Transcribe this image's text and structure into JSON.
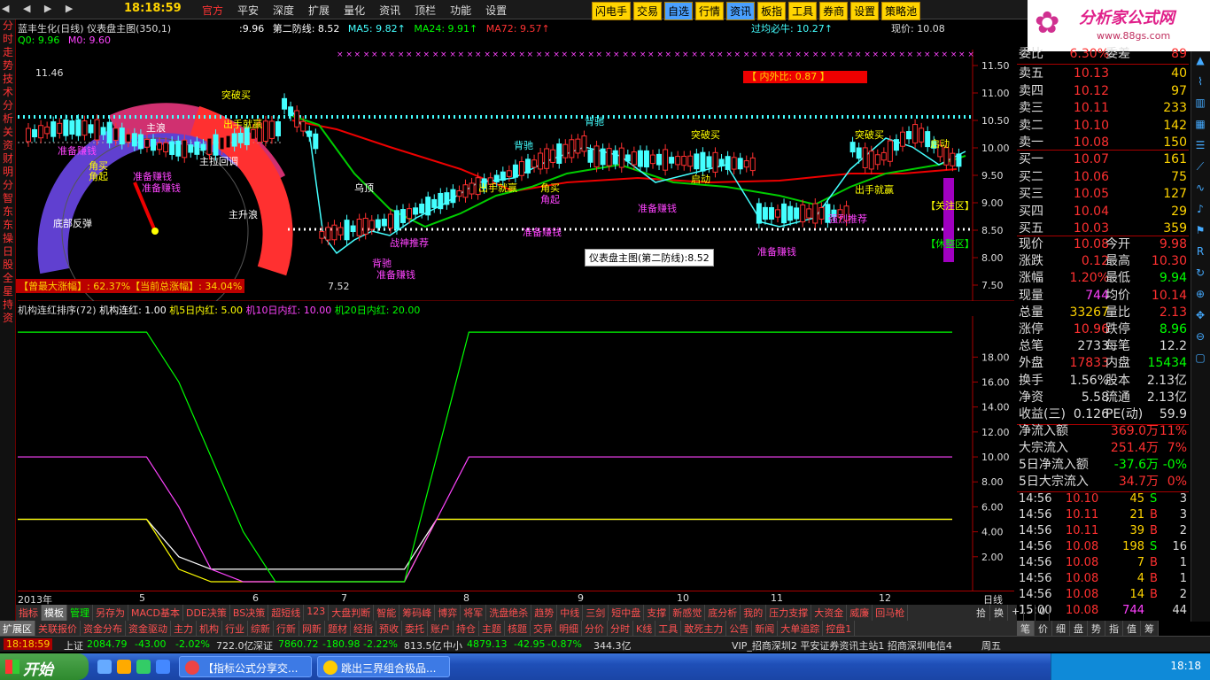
{
  "topbar": {
    "nav_symbols": "◀ ◀ ▶ ▶",
    "time": "18:18:59",
    "menu": [
      "官方",
      "平安",
      "深度",
      "扩展",
      "量化",
      "资讯",
      "顶栏",
      "功能",
      "设置"
    ],
    "tools": [
      "闪电手",
      "交易",
      "自选",
      "行情",
      "资讯",
      "板指",
      "工具",
      "券商",
      "设置",
      "策略池"
    ]
  },
  "logo": {
    "title": "分析家公式网",
    "url_text": "www.88gs.com"
  },
  "left_tabs": [
    "分",
    "时",
    "走",
    "势",
    "技",
    "术",
    "分",
    "析",
    "关",
    "资",
    "财",
    "明",
    "分",
    "智",
    "东",
    "东",
    "操",
    "日",
    "股",
    "全",
    "星",
    "持",
    "资"
  ],
  "chart_info": {
    "title": "蓝丰生化(日线) 仪表盘主图(350,1)",
    "line1_val": ":9.96",
    "second_defense": "第二防线: 8.52",
    "ma5": "MA5: 9.82↑",
    "ma24": "MA24: 9.91↑",
    "ma72": "MA72: 9.57↑",
    "q0": "Q0: 9.96",
    "m0": "M0: 9.60",
    "guojun": "过均必牛: 10.27↑",
    "price": "现价: 10.08"
  },
  "main_chart": {
    "y_ticks": [
      "11.50",
      "11.00",
      "10.50",
      "10.00",
      "9.50",
      "9.00",
      "8.50",
      "8.00",
      "7.50"
    ],
    "high_label": "11.46",
    "low_label": "7.52",
    "neiwai": "【 内外比: 0.87 】",
    "tooltip": "仪表盘主图(第二防线):8.52",
    "risk": "【曾最大涨幅】: 62.37%【当前总涨幅】: 34.04%",
    "gauge_labels": [
      "主浪",
      "主升浪",
      "底部反弹",
      "主拉回调"
    ],
    "signals": [
      "准备赚钱",
      "突破买",
      "出手就赢",
      "角买",
      "角起",
      "乌顶",
      "战神推荐",
      "背驰",
      "强烈推荐",
      "启动",
      "关注区",
      "休整区"
    ]
  },
  "sub_chart": {
    "title": "机构连红排序(72)",
    "l1": "机构连红: 1.00",
    "l2": "机5日内红: 5.00",
    "l3": "机10日内红: 10.00",
    "l4": "机20日内红: 20.00",
    "y_ticks": [
      "18.00",
      "16.00",
      "14.00",
      "12.00",
      "10.00",
      "8.00",
      "6.00",
      "4.00",
      "2.00"
    ],
    "series": [
      {
        "name": "机构连红",
        "values": [
          5,
          5,
          5,
          5,
          5,
          2,
          1,
          1,
          1,
          1,
          1,
          1,
          1,
          5,
          5,
          5,
          5,
          5,
          5,
          5,
          5,
          5,
          5,
          5,
          5,
          5,
          5,
          5,
          5,
          5
        ]
      },
      {
        "name": "机5日内红",
        "values": [
          5,
          5,
          5,
          5,
          5,
          1,
          0,
          0,
          0,
          0,
          0,
          0,
          0,
          5,
          5,
          5,
          5,
          5,
          5,
          5,
          5,
          5,
          5,
          5,
          5,
          5,
          5,
          5,
          5,
          5
        ]
      },
      {
        "name": "机10日内红",
        "values": [
          10,
          10,
          10,
          10,
          10,
          6,
          1,
          0,
          0,
          0,
          0,
          0,
          0,
          5,
          10,
          10,
          10,
          10,
          10,
          10,
          10,
          10,
          10,
          10,
          10,
          10,
          10,
          10,
          10,
          10
        ]
      },
      {
        "name": "机20日内红",
        "values": [
          20,
          20,
          20,
          20,
          20,
          16,
          10,
          4,
          0,
          0,
          0,
          0,
          0,
          10,
          20,
          20,
          20,
          20,
          20,
          20,
          20,
          20,
          20,
          20,
          20,
          20,
          20,
          20,
          20,
          20
        ]
      }
    ]
  },
  "x_axis": {
    "year": "2013年",
    "months": [
      "5",
      "6",
      "7",
      "8",
      "9",
      "10",
      "11",
      "12"
    ],
    "period": "日线"
  },
  "tabs1": [
    "指标",
    "模板",
    "管理",
    "另存为",
    "MACD基本",
    "DDE决策",
    "BS决策",
    "超短线",
    "123",
    "大盘判断",
    "智能",
    "筹码峰",
    "博弈",
    "将军",
    "洗盘绝杀",
    "趋势",
    "中线",
    "三剑",
    "短中盘",
    "支撑",
    "新感觉",
    "底分析",
    "我的",
    "压力支撑",
    "大资金",
    "威廉",
    "回马枪"
  ],
  "tabs2": [
    "扩展区",
    "关联报价",
    "资金分布",
    "资金驱动",
    "主力",
    "机构",
    "行业",
    "综新",
    "行新",
    "网新",
    "题材",
    "经指",
    "预收",
    "委托",
    "账户",
    "持仓",
    "主题",
    "核题",
    "交异",
    "明细",
    "分价",
    "分时",
    "K线",
    "工具",
    "敢死主力",
    "公告",
    "新闻",
    "大单追踪",
    "控盘1"
  ],
  "status": {
    "time": "18:18:59",
    "sh_label": "上证",
    "sh_val": "2084.79",
    "sh_chg": "-43.00",
    "sh_pct": "-2.02%",
    "sh_amt": "722.0亿",
    "sz_label": "深证",
    "sz_val": "7860.72",
    "sz_chg": "-180.98",
    "sz_pct": "-2.22%",
    "sz_amt": "813.5亿",
    "zx_label": "中小",
    "zx_val": "4879.13",
    "zx_chg": "-42.95",
    "zx_pct": "-0.87%",
    "zx_amt": "344.3亿",
    "scroll": "VIP_招商深圳2  平安证券资讯主站1  招商深圳电信4",
    "weekday": "周五"
  },
  "quote": {
    "weibi_label": "委比",
    "weibi": "6.30%",
    "weicha_label": "委差",
    "weicha": "89",
    "sells": [
      {
        "label": "卖五",
        "price": "10.13",
        "vol": "40"
      },
      {
        "label": "卖四",
        "price": "10.12",
        "vol": "97"
      },
      {
        "label": "卖三",
        "price": "10.11",
        "vol": "233"
      },
      {
        "label": "卖二",
        "price": "10.10",
        "vol": "142"
      },
      {
        "label": "卖一",
        "price": "10.08",
        "vol": "150"
      }
    ],
    "buys": [
      {
        "label": "买一",
        "price": "10.07",
        "vol": "161"
      },
      {
        "label": "买二",
        "price": "10.06",
        "vol": "75"
      },
      {
        "label": "买三",
        "price": "10.05",
        "vol": "127"
      },
      {
        "label": "买四",
        "price": "10.04",
        "vol": "29"
      },
      {
        "label": "买五",
        "price": "10.03",
        "vol": "359"
      }
    ],
    "stats": [
      {
        "l1": "现价",
        "v1": "10.08",
        "l2": "今开",
        "v2": "9.98",
        "c1": "#ff3030",
        "c2": "#ff3030"
      },
      {
        "l1": "涨跌",
        "v1": "0.12",
        "l2": "最高",
        "v2": "10.30",
        "c1": "#ff3030",
        "c2": "#ff3030"
      },
      {
        "l1": "涨幅",
        "v1": "1.20%",
        "l2": "最低",
        "v2": "9.94",
        "c1": "#ff3030",
        "c2": "#00ff00"
      },
      {
        "l1": "现量",
        "v1": "744",
        "l2": "均价",
        "v2": "10.14",
        "c1": "#ff40ff",
        "c2": "#ff3030"
      },
      {
        "l1": "总量",
        "v1": "33267",
        "l2": "量比",
        "v2": "2.13",
        "c1": "#ffd400",
        "c2": "#ff3030"
      },
      {
        "l1": "涨停",
        "v1": "10.96",
        "l2": "跌停",
        "v2": "8.96",
        "c1": "#ff3030",
        "c2": "#00ff00"
      },
      {
        "l1": "总笔",
        "v1": "2733",
        "l2": "每笔",
        "v2": "12.2",
        "c1": "#dddddd",
        "c2": "#dddddd"
      },
      {
        "l1": "外盘",
        "v1": "17833",
        "l2": "内盘",
        "v2": "15434",
        "c1": "#ff3030",
        "c2": "#00ff00"
      },
      {
        "l1": "换手",
        "v1": "1.56%",
        "l2": "股本",
        "v2": "2.13亿",
        "c1": "#dddddd",
        "c2": "#dddddd"
      },
      {
        "l1": "净资",
        "v1": "5.58",
        "l2": "流通",
        "v2": "2.13亿",
        "c1": "#dddddd",
        "c2": "#dddddd"
      },
      {
        "l1": "收益(三)",
        "v1": "0.126",
        "l2": "PE(动)",
        "v2": "59.9",
        "c1": "#dddddd",
        "c2": "#dddddd"
      }
    ],
    "flows": [
      {
        "label": "净流入额",
        "v1": "369.0万",
        "v2": "11%",
        "c": "#ff3030"
      },
      {
        "label": "大宗流入",
        "v1": "251.4万",
        "v2": "7%",
        "c": "#ff3030"
      },
      {
        "label": "5日净流入额",
        "v1": "-37.6万",
        "v2": "-0%",
        "c": "#00ff00"
      },
      {
        "label": "5日大宗流入",
        "v1": "34.7万",
        "v2": "0%",
        "c": "#ff3030"
      }
    ],
    "trades": [
      {
        "t": "14:56",
        "p": "10.10",
        "v": "45",
        "d": "S",
        "n": "3",
        "pc": "#ff3030",
        "vc": "#ffd400",
        "dc": "#00ff00"
      },
      {
        "t": "14:56",
        "p": "10.11",
        "v": "21",
        "d": "B",
        "n": "3",
        "pc": "#ff3030",
        "vc": "#ffd400",
        "dc": "#ff3030"
      },
      {
        "t": "14:56",
        "p": "10.11",
        "v": "39",
        "d": "B",
        "n": "2",
        "pc": "#ff3030",
        "vc": "#ffd400",
        "dc": "#ff3030"
      },
      {
        "t": "14:56",
        "p": "10.08",
        "v": "198",
        "d": "S",
        "n": "16",
        "pc": "#ff3030",
        "vc": "#ffd400",
        "dc": "#00ff00"
      },
      {
        "t": "14:56",
        "p": "10.08",
        "v": "7",
        "d": "B",
        "n": "1",
        "pc": "#ff3030",
        "vc": "#ffd400",
        "dc": "#ff3030"
      },
      {
        "t": "14:56",
        "p": "10.08",
        "v": "4",
        "d": "B",
        "n": "1",
        "pc": "#ff3030",
        "vc": "#ffd400",
        "dc": "#ff3030"
      },
      {
        "t": "14:56",
        "p": "10.08",
        "v": "14",
        "d": "B",
        "n": "2",
        "pc": "#ff3030",
        "vc": "#ffd400",
        "dc": "#ff3030"
      },
      {
        "t": "15:00",
        "p": "10.08",
        "v": "744",
        "d": "",
        "n": "44",
        "pc": "#ff3030",
        "vc": "#ff40ff",
        "dc": "#ff3030"
      }
    ]
  },
  "right_bottom": {
    "row1": [
      "拾",
      "换",
      "+",
      "-",
      "0"
    ],
    "row2": [
      "笔",
      "价",
      "细",
      "盘",
      "势",
      "指",
      "值",
      "筹"
    ]
  },
  "taskbar": {
    "start": "开始",
    "tasks": [
      "【指标公式分享交...",
      "跳出三界组合极品..."
    ],
    "clock": "18:18"
  }
}
